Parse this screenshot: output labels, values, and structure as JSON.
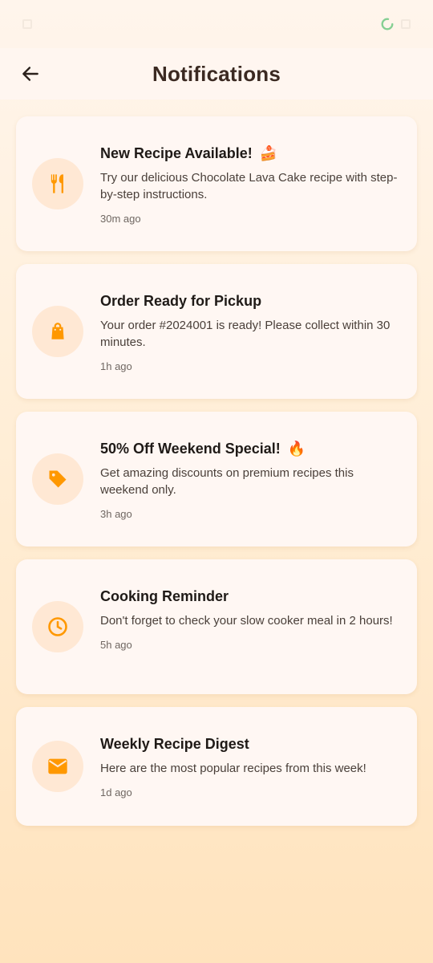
{
  "header": {
    "title": "Notifications"
  },
  "notifications": [
    {
      "title": "New Recipe Available!",
      "emoji": "🍰",
      "text": "Try our delicious Chocolate Lava Cake recipe with step-by-step instructions.",
      "time": "30m ago",
      "icon": "utensils-icon"
    },
    {
      "title": "Order Ready for Pickup",
      "emoji": "",
      "text": "Your order #2024001 is ready! Please collect within 30 minutes.",
      "time": "1h ago",
      "icon": "shopping-bag-icon"
    },
    {
      "title": "50% Off Weekend Special!",
      "emoji": "🔥",
      "text": "Get amazing discounts on premium recipes this weekend only.",
      "time": "3h ago",
      "icon": "tag-icon"
    },
    {
      "title": "Cooking Reminder",
      "emoji": "",
      "text": "Don't forget to check your slow cooker meal in 2 hours!",
      "time": "5h ago",
      "icon": "clock-icon"
    },
    {
      "title": "Weekly Recipe Digest",
      "emoji": "",
      "text": "Here are the most popular recipes from this week!",
      "time": "1d ago",
      "icon": "mail-icon"
    }
  ],
  "colors": {
    "accent": "#ff9800",
    "icon_bg": "#ffe8d4",
    "title": "#3b2a22"
  }
}
